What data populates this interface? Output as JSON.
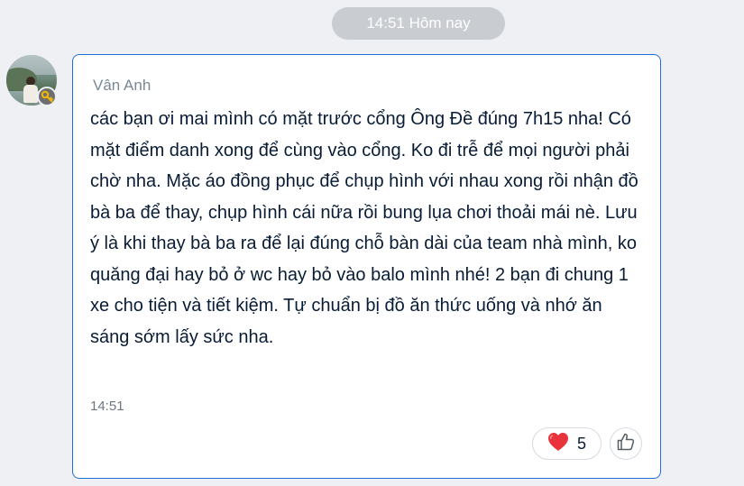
{
  "date_separator": "14:51 Hôm nay",
  "message": {
    "sender": "Vân Anh",
    "text": "các bạn ơi mai mình có mặt trước cổng Ông Đề đúng 7h15 nha! Có mặt điểm danh xong để cùng vào cổng. Ko đi trễ để mọi người phải chờ nha. Mặc áo đồng phục để chụp hình với nhau xong rồi nhận đồ bà ba để thay, chụp hình cái nữa rồi bung lụa chơi thoải mái nè. Lưu ý là khi thay bà ba ra để lại đúng chỗ bàn dài của team nhà mình, ko quăng đại hay bỏ ở wc hay bỏ vào balo mình nhé! 2 bạn đi chung 1 xe cho tiện và tiết kiệm. Tự chuẩn bị đồ ăn thức uống và nhớ ăn sáng sớm lấy sức nha.",
    "time": "14:51",
    "reaction": {
      "icon": "heart-icon",
      "count": "5",
      "color": "#e8323c"
    },
    "like_icon": "thumbs-up-icon",
    "border_color": "#1e6ed8"
  },
  "avatar_badge_icon": "key-icon",
  "key_color": "#f2b705"
}
